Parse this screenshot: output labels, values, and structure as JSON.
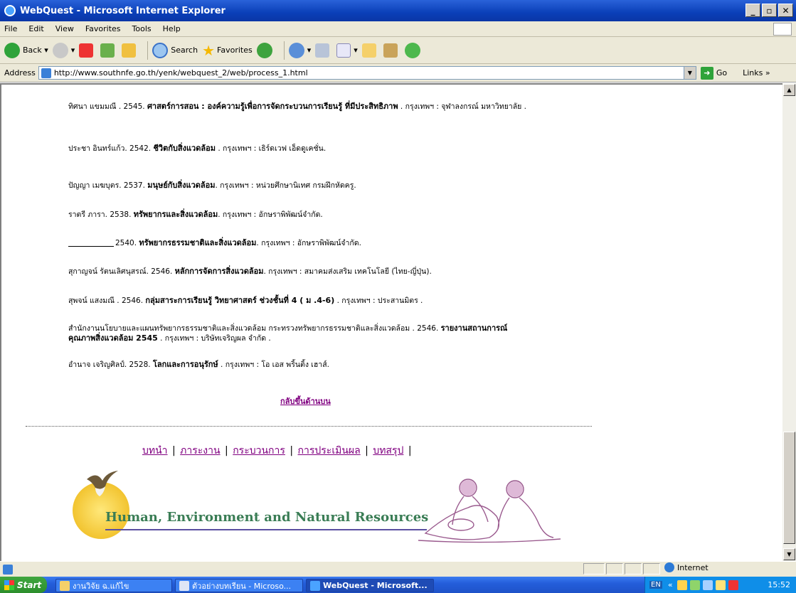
{
  "window": {
    "title": "WebQuest - Microsoft Internet Explorer"
  },
  "menu": [
    "File",
    "Edit",
    "View",
    "Favorites",
    "Tools",
    "Help"
  ],
  "toolbar": {
    "back": "Back",
    "search": "Search",
    "favorites": "Favorites"
  },
  "address": {
    "label": "Address",
    "url": "http://www.southnfe.go.th/yenk/webquest_2/web/process_1.html",
    "go": "Go",
    "links": "Links"
  },
  "references": [
    {
      "author": "ทิศนา แขมมณี . 2545. ",
      "title": "ศาสตร์การสอน : องค์ความรู้เพื่อการจัดกระบวนการเรียนรู้ ที่มีประสิทธิภาพ",
      "rest": " . กรุงเทพฯ : จุฬาลงกรณ์ มหาวิทยาลัย ."
    },
    {
      "author": "ประชา อินทร์แก้ว. 2542. ",
      "title": "ชีวิตกับสิ่งแวดล้อม",
      "rest": " . กรุงเทพฯ : เธิร์ดเวฟ เอ็ดดูเคชั่น."
    },
    {
      "author": "ปัญญา เมฆบุตร. 2537. ",
      "title": "มนุษย์กับสิ่งแวดล้อม",
      "rest": ". กรุงเทพฯ : หน่วยศึกษานิเทศ กรมฝึกหัดครู."
    },
    {
      "author": "ราตรี ภารา. 2538. ",
      "title": "ทรัพยากรและสิ่งแวดล้อม",
      "rest": ". กรุงเทพฯ : อักษราพิพัฒน์จำกัด."
    },
    {
      "author": "2540. ",
      "title": "ทรัพยากรธรรมชาติและสิ่งแวดล้อม",
      "rest": ". กรุงเทพฯ : อักษราพิพัฒน์จำกัด."
    },
    {
      "author": "สุกาญจน์ รัตนเลิศนุสรณ์. 2546. ",
      "title": "หลักการจัดการสิ่งแวดล้อม",
      "rest": ". กรุงเทพฯ : สมาคมส่งเสริม เทคโนโลยี (ไทย-ญี่ปุ่น)."
    },
    {
      "author": "สุพจน์ แสงมณี . 2546. ",
      "title": "กลุ่มสาระการเรียนรู้ วิทยาศาสตร์ ช่วงชั้นที่ 4 ( ม .4-6)",
      "rest": " . กรุงเทพฯ : ประสานมิตร ."
    },
    {
      "author": "สำนักงานนโยบายและแผนทรัพยากรธรรมชาติและสิ่งแวดล้อม กระทรวงทรัพยากรธรรมชาติและสิ่งแวดล้อม . 2546. ",
      "title": "รายงานสถานการณ์คุณภาพสิ่งแวดล้อม 2545",
      "rest": " . กรุงเทพฯ : บริษัทเจริญผล จำกัด ."
    },
    {
      "author": "อำนาจ เจริญศิลป์. 2528. ",
      "title": "โลกและการอนุรักษ์",
      "rest": " . กรุงเทพฯ : โอ เอส พริ้นติ้ง เฮาส์."
    }
  ],
  "back_to_top": "กลับขึ้นด้านบน",
  "nav": [
    "บทนำ",
    "ภาระงาน",
    "กระบวนการ",
    "การประเมินผล",
    "บทสรุป"
  ],
  "banner": {
    "title": "Human, Environment and Natural Resources"
  },
  "status": {
    "zone": "Internet"
  },
  "taskbar": {
    "start": "Start",
    "tasks": [
      "งานวิจัย ฉ.แก้ไข",
      "ตัวอย่างบทเรียน - Microso...",
      "WebQuest - Microsoft..."
    ],
    "lang": "EN",
    "clock": "15:52"
  },
  "colors": {
    "titlebar": "#0a3fb8",
    "visited_link": "#800080",
    "banner_title": "#3a7d55",
    "taskbar": "#245edb"
  }
}
